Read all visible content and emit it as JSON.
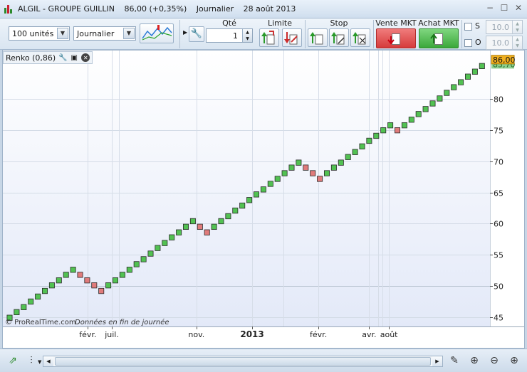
{
  "window": {
    "symbol": "ALGIL - GROUPE GUILLIN",
    "quote": "86,00 (+0,35%)",
    "period": "Journalier",
    "date": "28 août 2013"
  },
  "toolbar": {
    "units_select": "100 unités",
    "period_select": "Journalier",
    "qty_label": "Qté",
    "qty_value": "1",
    "limit_label": "Limite",
    "stop_label": "Stop",
    "sell_label": "Vente MKT",
    "buy_label": "Achat MKT",
    "s_label": "S",
    "o_label": "O",
    "s_value": "10.0",
    "o_value": "10.0"
  },
  "indicator": {
    "label": "Renko (0,86)"
  },
  "watermark": {
    "source": "© ProRealTime.com",
    "note": "Données en fin de journée"
  },
  "colors": {
    "up": "#52c152",
    "down": "#e07b7b",
    "current_price_bg": "#f0b020",
    "prev_price_bg": "#8fd08f"
  },
  "chart_data": {
    "type": "renko",
    "brick_size": 0.86,
    "last_price": "86,00",
    "prev_price": "85,70",
    "ylim": [
      43.5,
      87.8
    ],
    "y_ticks": [
      45,
      50,
      55,
      60,
      65,
      70,
      75,
      80
    ],
    "y_tick_labels": [
      "45",
      "50",
      "55",
      "60",
      "65",
      "70",
      "75",
      "80"
    ],
    "x_labels": [
      {
        "label": "févr.",
        "index": 11.1,
        "bold": false
      },
      {
        "label": "juil.",
        "index": 14.5,
        "bold": false
      },
      {
        "label": "nov.",
        "index": 26.5,
        "bold": false
      },
      {
        "label": "2013",
        "index": 34.4,
        "bold": true
      },
      {
        "label": "févr.",
        "index": 43.8,
        "bold": false
      },
      {
        "label": "avr.",
        "index": 51.0,
        "bold": false
      },
      {
        "label": "août",
        "index": 53.8,
        "bold": false
      }
    ],
    "x_gridlines": [
      11.1,
      14.5,
      15.5,
      26.5,
      34.4,
      38.8,
      43.8,
      51.0,
      52.3,
      52.9,
      53.8
    ],
    "bricks": [
      {
        "v": 44.9,
        "d": 1
      },
      {
        "v": 45.8,
        "d": 1
      },
      {
        "v": 46.6,
        "d": 1
      },
      {
        "v": 47.5,
        "d": 1
      },
      {
        "v": 48.3,
        "d": 1
      },
      {
        "v": 49.2,
        "d": 1
      },
      {
        "v": 50.1,
        "d": 1
      },
      {
        "v": 50.9,
        "d": 1
      },
      {
        "v": 51.8,
        "d": 1
      },
      {
        "v": 52.6,
        "d": 1
      },
      {
        "v": 51.8,
        "d": -1
      },
      {
        "v": 50.9,
        "d": -1
      },
      {
        "v": 50.1,
        "d": -1
      },
      {
        "v": 49.2,
        "d": -1
      },
      {
        "v": 50.1,
        "d": 1
      },
      {
        "v": 50.9,
        "d": 1
      },
      {
        "v": 51.8,
        "d": 1
      },
      {
        "v": 52.6,
        "d": 1
      },
      {
        "v": 53.5,
        "d": 1
      },
      {
        "v": 54.3,
        "d": 1
      },
      {
        "v": 55.2,
        "d": 1
      },
      {
        "v": 56.1,
        "d": 1
      },
      {
        "v": 56.9,
        "d": 1
      },
      {
        "v": 57.8,
        "d": 1
      },
      {
        "v": 58.6,
        "d": 1
      },
      {
        "v": 59.5,
        "d": 1
      },
      {
        "v": 60.4,
        "d": 1
      },
      {
        "v": 59.5,
        "d": -1
      },
      {
        "v": 58.6,
        "d": -1
      },
      {
        "v": 59.5,
        "d": 1
      },
      {
        "v": 60.4,
        "d": 1
      },
      {
        "v": 61.2,
        "d": 1
      },
      {
        "v": 62.1,
        "d": 1
      },
      {
        "v": 62.9,
        "d": 1
      },
      {
        "v": 63.8,
        "d": 1
      },
      {
        "v": 64.7,
        "d": 1
      },
      {
        "v": 65.5,
        "d": 1
      },
      {
        "v": 66.4,
        "d": 1
      },
      {
        "v": 67.2,
        "d": 1
      },
      {
        "v": 68.1,
        "d": 1
      },
      {
        "v": 69.0,
        "d": 1
      },
      {
        "v": 69.8,
        "d": 1
      },
      {
        "v": 69.0,
        "d": -1
      },
      {
        "v": 68.1,
        "d": -1
      },
      {
        "v": 67.2,
        "d": -1
      },
      {
        "v": 68.1,
        "d": 1
      },
      {
        "v": 69.0,
        "d": 1
      },
      {
        "v": 69.8,
        "d": 1
      },
      {
        "v": 70.7,
        "d": 1
      },
      {
        "v": 71.5,
        "d": 1
      },
      {
        "v": 72.4,
        "d": 1
      },
      {
        "v": 73.3,
        "d": 1
      },
      {
        "v": 74.1,
        "d": 1
      },
      {
        "v": 75.0,
        "d": 1
      },
      {
        "v": 75.8,
        "d": 1
      },
      {
        "v": 75.0,
        "d": -1
      },
      {
        "v": 75.8,
        "d": 1
      },
      {
        "v": 76.7,
        "d": 1
      },
      {
        "v": 77.6,
        "d": 1
      },
      {
        "v": 78.4,
        "d": 1
      },
      {
        "v": 79.3,
        "d": 1
      },
      {
        "v": 80.1,
        "d": 1
      },
      {
        "v": 81.0,
        "d": 1
      },
      {
        "v": 81.9,
        "d": 1
      },
      {
        "v": 82.7,
        "d": 1
      },
      {
        "v": 83.6,
        "d": 1
      },
      {
        "v": 84.4,
        "d": 1
      },
      {
        "v": 85.3,
        "d": 1
      }
    ]
  }
}
